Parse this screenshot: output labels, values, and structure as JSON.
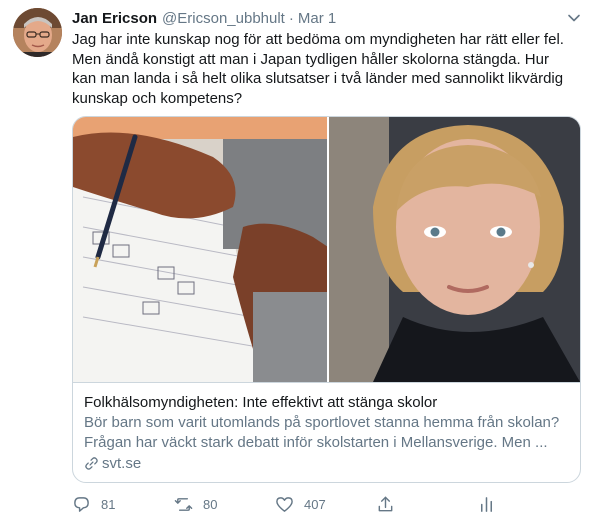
{
  "tweet": {
    "author_name": "Jan Ericson",
    "author_handle": "@Ericson_ubbhult",
    "separator": "·",
    "date": "Mar 1",
    "text": "Jag har inte kunskap nog för att bedöma om myndigheten har rätt eller fel. Men ändå konstigt att man i Japan tydligen håller skolorna stängda. Hur kan man landa i så helt olika slutsatser i två länder med sannolikt likvärdig kunskap och kompetens?"
  },
  "card": {
    "title": "Folkhälsomyndigheten: Inte effektivt att stänga skolor",
    "description": "Bör barn som varit utomlands på sportlovet stanna hemma från skolan? Frågan har väckt stark debatt inför skolstarten i Mellansverige. Men ...",
    "domain": "svt.se"
  },
  "actions": {
    "reply_count": "81",
    "retweet_count": "80",
    "like_count": "407",
    "icons": [
      "reply-icon",
      "retweet-icon",
      "like-icon",
      "share-icon",
      "analytics-icon"
    ]
  },
  "colors": {
    "text_primary": "#14171a",
    "text_secondary": "#657786",
    "border": "#ccd6dd",
    "background": "#ffffff"
  }
}
